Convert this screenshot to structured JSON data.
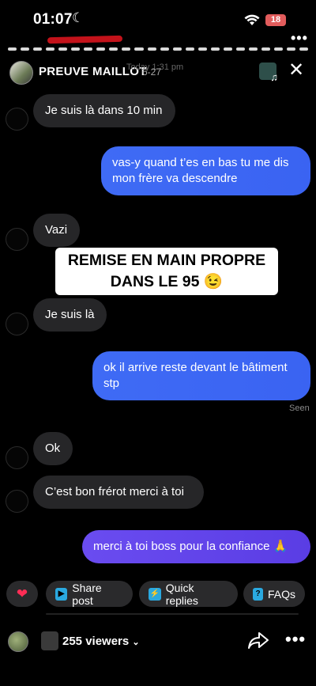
{
  "status_bar": {
    "time": "01:07",
    "battery": "18"
  },
  "header": {
    "title": "PREUVE MAILLOT",
    "time": "6-27",
    "faint_date": "Today 1:31 pm"
  },
  "messages": [
    {
      "side": "received",
      "text": "Je suis là dans 10 min"
    },
    {
      "side": "sent",
      "text": "vas-y quand t’es en bas tu me dis mon frère va descendre"
    },
    {
      "side": "received",
      "text": "Vazi"
    },
    {
      "side": "received",
      "text": "Je suis là"
    },
    {
      "side": "sent",
      "text": "ok il arrive reste devant le bâtiment stp"
    },
    {
      "side": "received",
      "text": "Ok"
    },
    {
      "side": "received",
      "text": "C’est bon frérot merci à toi"
    },
    {
      "side": "sent",
      "text": "merci à toi boss pour la confiance 🙏"
    }
  ],
  "overlay": {
    "line1": "REMISE EN MAIN PROPRE",
    "line2": "DANS LE 95 😉"
  },
  "seen_label": "Seen",
  "actions": {
    "heart": "❤",
    "share_post": "Share post",
    "quick_replies": "Quick replies",
    "faqs": "FAQs"
  },
  "bottom": {
    "viewers": "255 viewers"
  },
  "colors": {
    "sent_bubble": "#3f6bf5",
    "received_bubble": "#262628",
    "heart": "#ff2d55",
    "battery": "#e25c5c"
  }
}
